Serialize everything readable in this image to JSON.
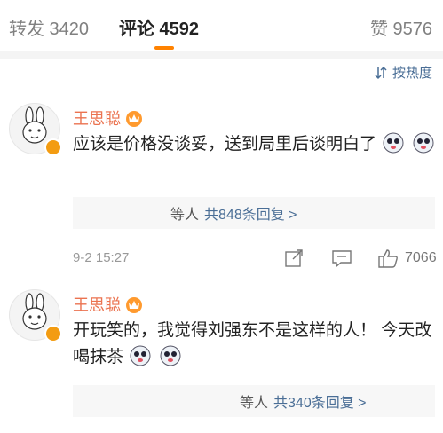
{
  "tabs": {
    "repost": "转发 3420",
    "comment": "评论 4592",
    "like": "赞 9576"
  },
  "sort": {
    "label": "按热度",
    "icon": "sort-icon"
  },
  "comments": [
    {
      "username": "王思聪",
      "content": "应该是价格没谈妥，送到局里后谈明白了",
      "replies": {
        "who": "等人",
        "label": "共848条回复 >"
      },
      "time": "9-2 15:27",
      "like_count": "7066"
    },
    {
      "username": "王思聪",
      "content": "开玩笑的，我觉得刘强东不是这样的人！ 今天改喝抹茶",
      "replies": {
        "who": "等人",
        "label": "共340条回复 >"
      }
    }
  ],
  "colors": {
    "accent": "#ff8200",
    "username": "#eb7350",
    "link": "#4a6e96",
    "verified": "#f39c12"
  }
}
